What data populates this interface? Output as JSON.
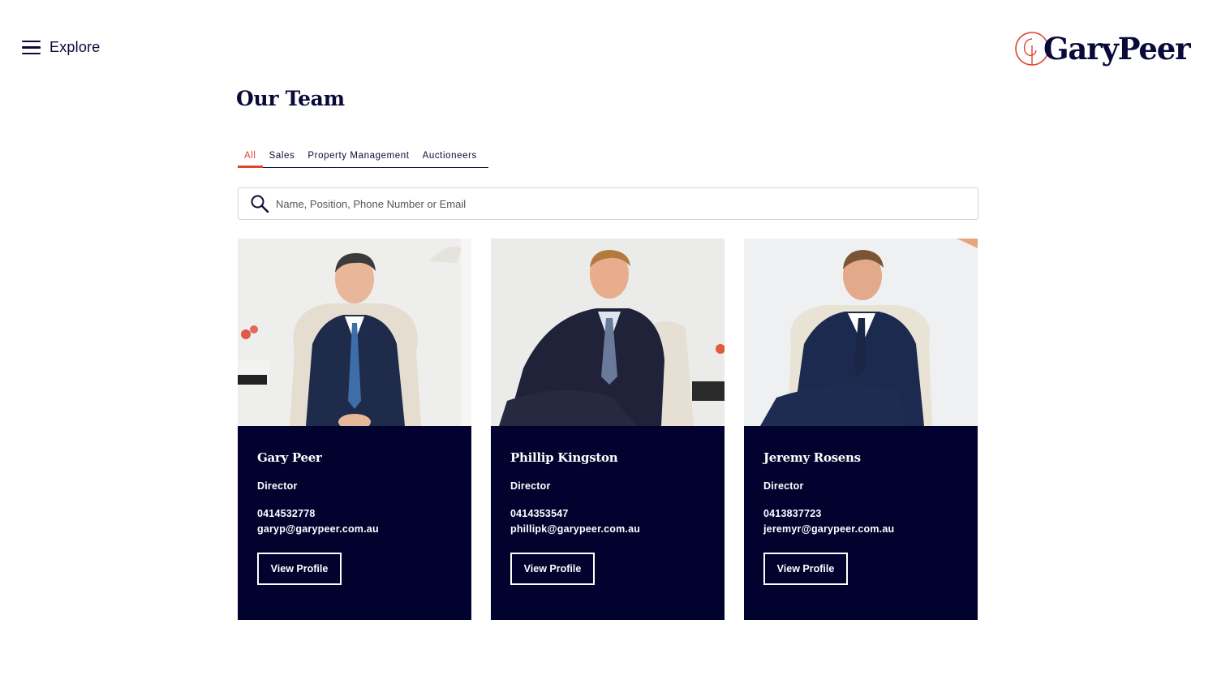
{
  "header": {
    "menu_label": "Explore",
    "logo_text": "GaryPeer",
    "brand_color": "#e0452e",
    "navy": "#02022f"
  },
  "page": {
    "title": "Our Team"
  },
  "tabs": [
    {
      "label": "All",
      "active": true
    },
    {
      "label": "Sales",
      "active": false
    },
    {
      "label": "Property Management",
      "active": false
    },
    {
      "label": "Auctioneers",
      "active": false
    }
  ],
  "search": {
    "placeholder": "Name, Position, Phone Number or Email",
    "value": ""
  },
  "team": [
    {
      "name": "Gary Peer",
      "position": "Director",
      "phone": "0414532778",
      "email": "garyp@garypeer.com.au",
      "button": "View Profile"
    },
    {
      "name": "Phillip Kingston",
      "position": "Director",
      "phone": "0414353547",
      "email": "phillipk@garypeer.com.au",
      "button": "View Profile"
    },
    {
      "name": "Jeremy Rosens",
      "position": "Director",
      "phone": "0413837723",
      "email": "jeremyr@garypeer.com.au",
      "button": "View Profile"
    }
  ]
}
